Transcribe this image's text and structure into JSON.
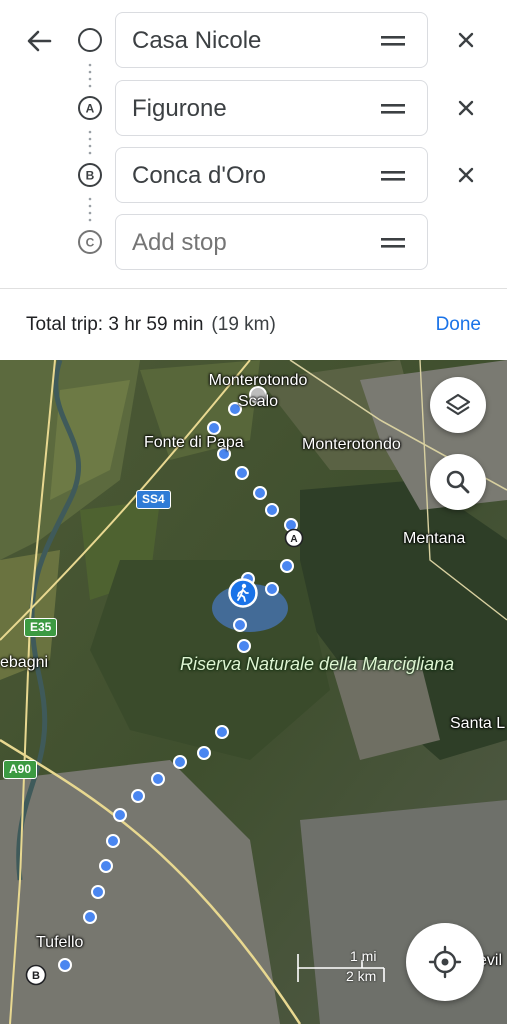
{
  "stops": [
    {
      "value": "Casa Nicole",
      "marker": "circle-empty",
      "removable": true
    },
    {
      "value": "Figurone",
      "marker": "A",
      "removable": true
    },
    {
      "value": "Conca d'Oro",
      "marker": "B",
      "removable": true
    },
    {
      "value": "",
      "placeholder": "Add stop",
      "marker": "C",
      "removable": false
    }
  ],
  "trip": {
    "summary": "Total trip: 3 hr 59 min",
    "distance": "(19 km)",
    "done_label": "Done"
  },
  "map": {
    "labels": {
      "monterotondo_scalo": "Monterotondo Scalo",
      "fonte_di_papa": "Fonte di Papa",
      "monterotondo": "Monterotondo",
      "mentana": "Mentana",
      "settebagni": "ebagni",
      "riserva": "Riserva Naturale della Marcigliana",
      "santa_lucia": "Santa L",
      "tufello": "Tufello",
      "right_edge": "evil"
    },
    "road_shields": {
      "ss4": "SS4",
      "e35": "E35",
      "a90": "A90"
    },
    "route_markers": {
      "a": "A",
      "b": "B"
    },
    "scale": {
      "miles": "1 mi",
      "km": "2 km"
    },
    "route_color": "#4a86f0",
    "accent_color": "#1a73e8",
    "icons": {
      "layers": "layers-icon",
      "search": "search-icon",
      "locate": "my-location-icon",
      "walking": "walking-person-icon"
    }
  }
}
